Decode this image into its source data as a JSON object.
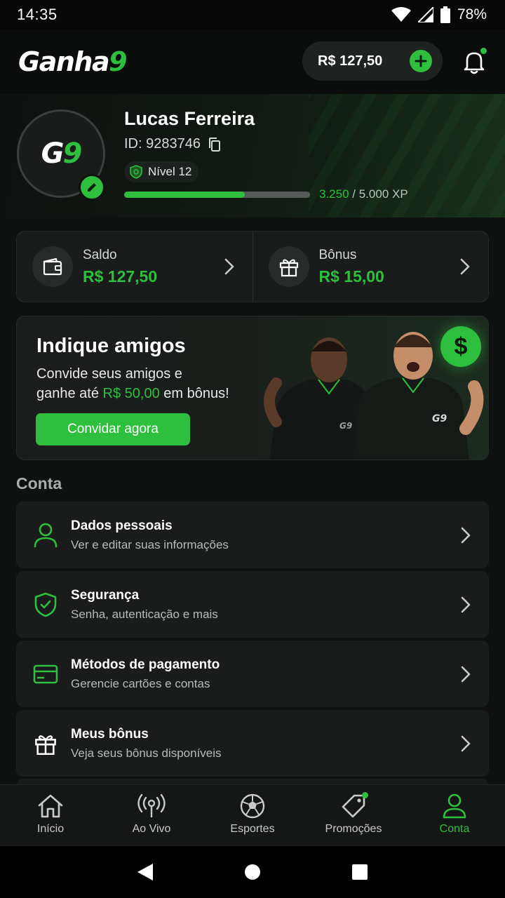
{
  "status_bar": {
    "time": "14:35",
    "battery": "78%"
  },
  "header": {
    "logo_text": "Ganha",
    "logo_number": "9",
    "balance": "R$ 127,50"
  },
  "profile": {
    "avatar_text": "G",
    "avatar_number": "9",
    "name": "Lucas Ferreira",
    "id_label": "ID: 9283746",
    "level": "Nível 12",
    "xp_current": "3.250",
    "xp_total": "/ 5.000 XP",
    "xp_progress": 0.65
  },
  "wallet": {
    "saldo_label": "Saldo",
    "saldo_value": "R$ 127,50",
    "bonus_label": "Bônus",
    "bonus_value": "R$ 15,00"
  },
  "promo": {
    "title": "Indique amigos",
    "desc_1": "Convide seus amigos e",
    "desc_2": "ganhe até",
    "desc_amount": "R$ 50,00",
    "desc_3": "em bônus!",
    "cta": "Convidar agora",
    "coin_symbol": "$",
    "jersey_text": "G9"
  },
  "account": {
    "section_title": "Conta",
    "items": [
      {
        "title": "Dados pessoais",
        "subtitle": "Ver e editar suas informações",
        "icon": "user-icon"
      },
      {
        "title": "Segurança",
        "subtitle": "Senha, autenticação e mais",
        "icon": "shield-icon"
      },
      {
        "title": "Métodos de pagamento",
        "subtitle": "Gerencie cartões e contas",
        "icon": "card-icon"
      },
      {
        "title": "Meus bônus",
        "subtitle": "Veja seus bônus disponíveis",
        "icon": "gift-icon"
      }
    ]
  },
  "bottom_nav": [
    {
      "label": "Início",
      "icon": "home-icon"
    },
    {
      "label": "Ao Vivo",
      "icon": "live-icon"
    },
    {
      "label": "Esportes",
      "icon": "soccer-ball-icon"
    },
    {
      "label": "Promoções",
      "icon": "tag-icon"
    },
    {
      "label": "Conta",
      "icon": "user-icon",
      "active": true
    }
  ],
  "colors": {
    "accent": "#2fbf3e",
    "background": "#0f1110",
    "card": "#1a1c1b"
  }
}
